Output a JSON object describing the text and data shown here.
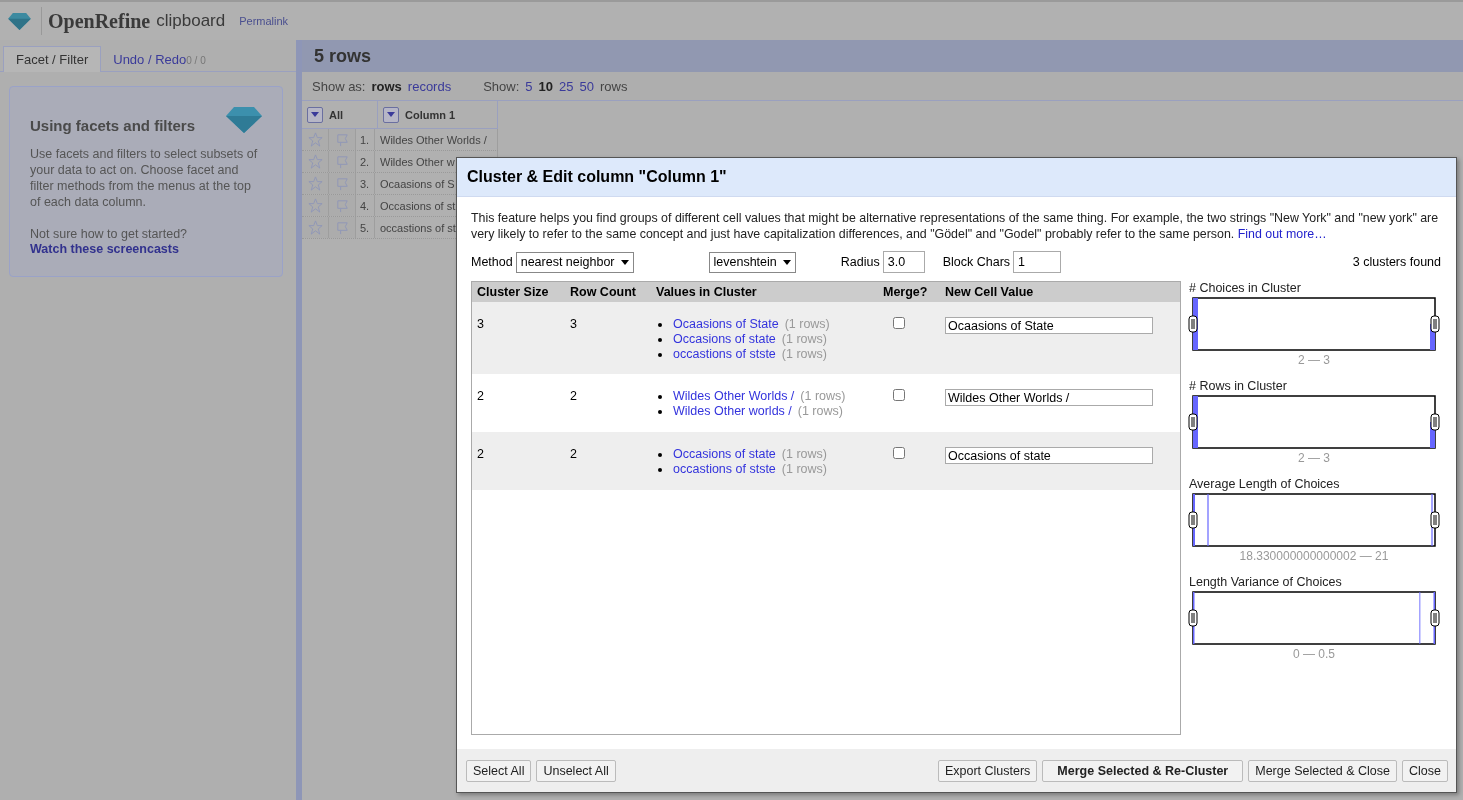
{
  "header": {
    "app_name": "OpenRefine",
    "project_name": "clipboard",
    "permalink": "Permalink"
  },
  "left_tabs": [
    {
      "label": "Facet / Filter",
      "selected": true
    },
    {
      "label": "Undo / Redo",
      "count": "0 / 0",
      "selected": false
    }
  ],
  "help_panel": {
    "title": "Using facets and filters",
    "body": "Use facets and filters to select subsets of your data to act on. Choose facet and filter methods from the menus at the top of each data column.",
    "question": "Not sure how to get started?",
    "link": "Watch these screencasts"
  },
  "view": {
    "row_count": "5 rows",
    "show_as_label": "Show as:",
    "show_as": [
      {
        "label": "rows",
        "selected": true
      },
      {
        "label": "records",
        "selected": false
      }
    ],
    "show_label": "Show:",
    "page_sizes": [
      {
        "label": "5",
        "selected": false
      },
      {
        "label": "10",
        "selected": true
      },
      {
        "label": "25",
        "selected": false
      },
      {
        "label": "50",
        "selected": false
      }
    ],
    "page_sizes_suffix": "rows"
  },
  "grid": {
    "columns": [
      "All",
      "Column 1"
    ],
    "rows": [
      {
        "index": "1.",
        "value": "Wildes Other Worlds /"
      },
      {
        "index": "2.",
        "value": "Wildes Other w"
      },
      {
        "index": "3.",
        "value": "Ocaasions of S"
      },
      {
        "index": "4.",
        "value": "Occasions of st"
      },
      {
        "index": "5.",
        "value": "occastions of st"
      }
    ]
  },
  "dialog": {
    "title": "Cluster & Edit column \"Column 1\"",
    "description": "This feature helps you find groups of different cell values that might be alternative representations of the same thing. For example, the two strings \"New York\" and \"new york\" are very likely to refer to the same concept and just have capitalization differences, and \"Gödel\" and \"Godel\" probably refer to the same person.",
    "find_out_more": "Find out more…",
    "method": {
      "label": "Method",
      "value": "nearest neighbor"
    },
    "function": "levenshtein",
    "radius": {
      "label": "Radius",
      "value": "3.0"
    },
    "block_chars": {
      "label": "Block Chars",
      "value": "1"
    },
    "clusters_found": "3 clusters found",
    "columns": [
      "Cluster Size",
      "Row Count",
      "Values in Cluster",
      "Merge?",
      "New Cell Value"
    ],
    "clusters": [
      {
        "size": "3",
        "row_count": "3",
        "values": [
          {
            "text": "Ocaasions of State",
            "count": "(1 rows)"
          },
          {
            "text": "Occasions of state",
            "count": "(1 rows)"
          },
          {
            "text": "occastions of stste",
            "count": "(1 rows)"
          }
        ],
        "merge": false,
        "new_value": "Ocaasions of State"
      },
      {
        "size": "2",
        "row_count": "2",
        "values": [
          {
            "text": "Wildes Other Worlds /",
            "count": "(1 rows)"
          },
          {
            "text": "Wildes Other worlds /",
            "count": "(1 rows)"
          }
        ],
        "merge": false,
        "new_value": "Wildes Other Worlds /"
      },
      {
        "size": "2",
        "row_count": "2",
        "values": [
          {
            "text": "Occasions of state",
            "count": "(1 rows)"
          },
          {
            "text": "occastions of stste",
            "count": "(1 rows)"
          }
        ],
        "merge": false,
        "new_value": "Occasions of state"
      }
    ],
    "histograms": [
      {
        "title": "# Choices in Cluster",
        "range": "2 — 3"
      },
      {
        "title": "# Rows in Cluster",
        "range": "2 — 3"
      },
      {
        "title": "Average Length of Choices",
        "range": "18.330000000000002 — 21"
      },
      {
        "title": "Length Variance of Choices",
        "range": "0 — 0.5"
      }
    ],
    "left_buttons": [
      "Select All",
      "Unselect All"
    ],
    "right_buttons": [
      {
        "label": "Export Clusters",
        "primary": false
      },
      {
        "label": "Merge Selected & Re-Cluster",
        "primary": true
      },
      {
        "label": "Merge Selected & Close",
        "primary": false
      },
      {
        "label": "Close",
        "primary": false
      }
    ]
  }
}
